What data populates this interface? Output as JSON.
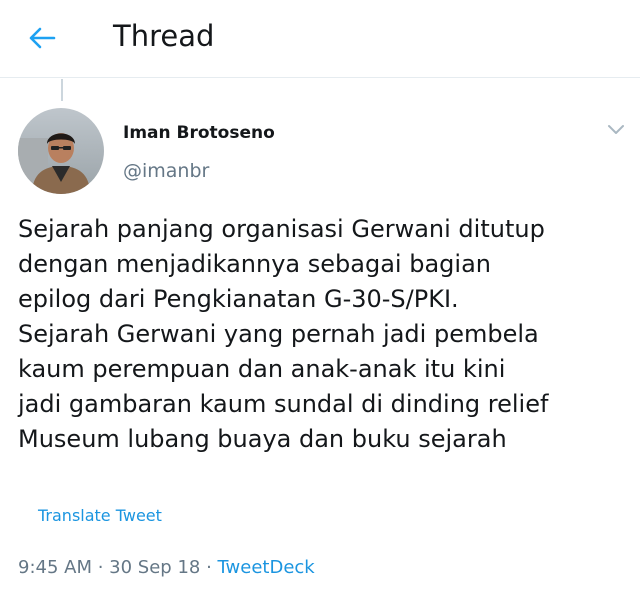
{
  "header": {
    "title": "Thread",
    "back_icon": "arrow-left-icon",
    "accent_color": "#1da1f2"
  },
  "tweet": {
    "author": {
      "name": "Iman Brotoseno",
      "handle": "@imanbr"
    },
    "text": "Sejarah panjang organisasi Gerwani ditutup\ndengan menjadikannya sebagai bagian\nepilog dari Pengkianatan G-30-S/PKI.\nSejarah Gerwani yang pernah jadi pembela\nkaum perempuan dan anak-anak itu kini\njadi gambaran kaum sundal di dinding relief\nMuseum lubang buaya dan buku sejarah",
    "translate_label": "Translate Tweet",
    "time": "9:45 AM",
    "sep1": " · ",
    "date": "30 Sep 18",
    "sep2": " · ",
    "source": "TweetDeck"
  }
}
